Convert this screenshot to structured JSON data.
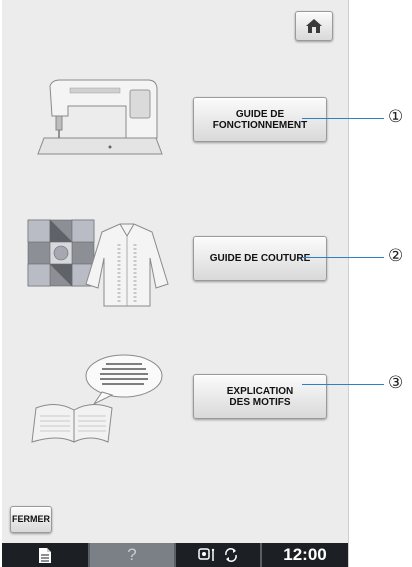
{
  "home_button": {
    "icon": "home-icon"
  },
  "menu": [
    {
      "label": "GUIDE DE\nFONCTIONNEMENT",
      "callout": "①",
      "illustration": "sewing-machine"
    },
    {
      "label": "GUIDE DE COUTURE",
      "callout": "②",
      "illustration": "quilt-and-shirt"
    },
    {
      "label": "EXPLICATION\nDES MOTIFS",
      "callout": "③",
      "illustration": "book-with-speech-bubble"
    }
  ],
  "close_button": {
    "label": "FERMER"
  },
  "statusbar": {
    "icons": [
      "page-icon",
      "help-icon",
      "bobbin-icon",
      "refresh-icon"
    ],
    "time": "12:00"
  },
  "colors": {
    "callout_line": "#2f7fc8",
    "screen_bg": "#ececec",
    "statusbar_bg": "#1c1f24"
  }
}
